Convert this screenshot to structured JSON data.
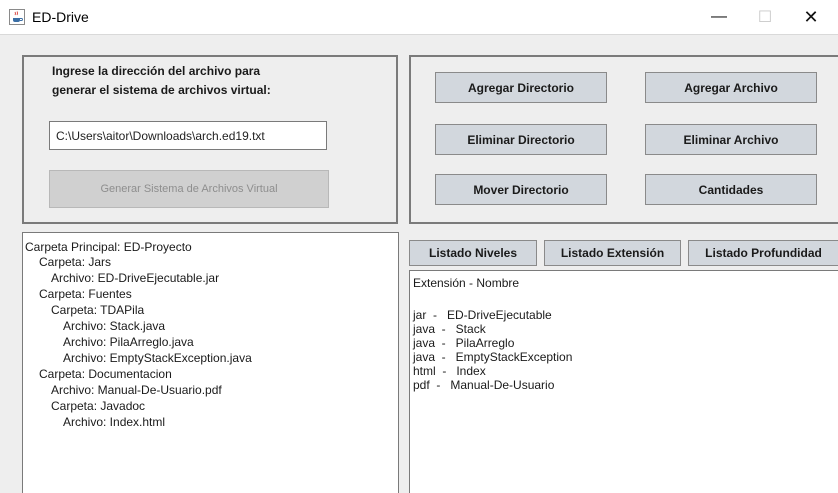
{
  "window": {
    "title": "ED-Drive",
    "minimize_glyph": "—",
    "maximize_glyph": "☐",
    "close_glyph": "✕"
  },
  "input_section": {
    "instruction_line1": "Ingrese la dirección del archivo para",
    "instruction_line2": "generar el sistema de archivos virtual:",
    "path_value": "C:\\Users\\aitor\\Downloads\\arch.ed19.txt",
    "generate_button": "Generar Sistema de Archivos Virtual"
  },
  "actions": {
    "add_directory": "Agregar Directorio",
    "add_file": "Agregar Archivo",
    "delete_directory": "Eliminar Directorio",
    "delete_file": "Eliminar Archivo",
    "move_directory": "Mover Directorio",
    "quantities": "Cantidades"
  },
  "tree": [
    "Carpeta Principal: ED-Proyecto",
    "Carpeta: Jars",
    "Archivo: ED-DriveEjecutable.jar",
    "Carpeta: Fuentes",
    "Carpeta: TDAPila",
    "Archivo: Stack.java",
    "Archivo: PilaArreglo.java",
    "Archivo: EmptyStackException.java",
    "Carpeta: Documentacion",
    "Archivo: Manual-De-Usuario.pdf",
    "Carpeta: Javadoc",
    "Archivo: Index.html"
  ],
  "listing_buttons": {
    "levels": "Listado Niveles",
    "extension": "Listado Extensión",
    "depth": "Listado Profundidad"
  },
  "result": {
    "header": "Extensión - Nombre",
    "lines": [
      "jar  -   ED-DriveEjecutable",
      "java  -   Stack",
      "java  -   PilaArreglo",
      "java  -   EmptyStackException",
      "html  -   Index",
      "pdf  -   Manual-De-Usuario"
    ]
  },
  "colors": {
    "button_bg": "#d2d7dd",
    "panel_border": "#7a7a7a"
  }
}
